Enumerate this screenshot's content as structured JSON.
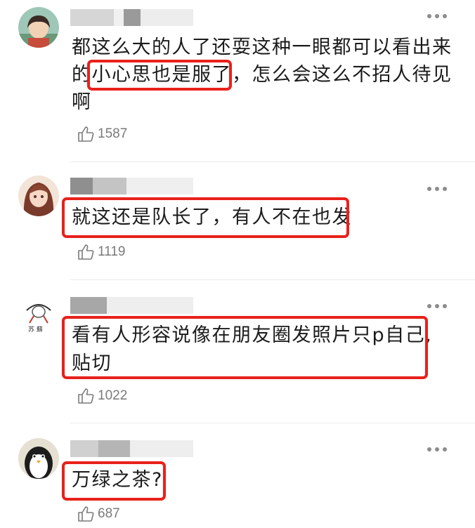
{
  "comments": [
    {
      "avatar": "cartoon-girl-avatar",
      "lines": [
        "都这么大的人了还耍这种一眼都可以看出来",
        "的小心思也是服了，怎么会这么不招人待见",
        "啊"
      ],
      "highlight": "小心思也是服了",
      "likes": "1587"
    },
    {
      "avatar": "anime-girl-avatar",
      "lines": [
        "就这还是队长了，有人不在也发"
      ],
      "highlight": "就这还是队长了，有人不在也发",
      "likes": "1119"
    },
    {
      "avatar": "ink-sketch-avatar",
      "lines": [
        "看有人形容说像在朋友圈发照片只p自己,",
        "贴切"
      ],
      "highlight": "看有人形容说像在朋友圈发照片只p自己, 贴切",
      "likes": "1022"
    },
    {
      "avatar": "penguin-avatar",
      "lines": [
        "万绿之茶?"
      ],
      "highlight": "万绿之茶?",
      "likes": "687"
    }
  ],
  "icons": {
    "like": "thumbs-up-icon",
    "more": "more-dots-icon"
  },
  "colors": {
    "highlight_border": "#e8211b",
    "count": "#7a7a7a",
    "divider": "#ececec"
  }
}
